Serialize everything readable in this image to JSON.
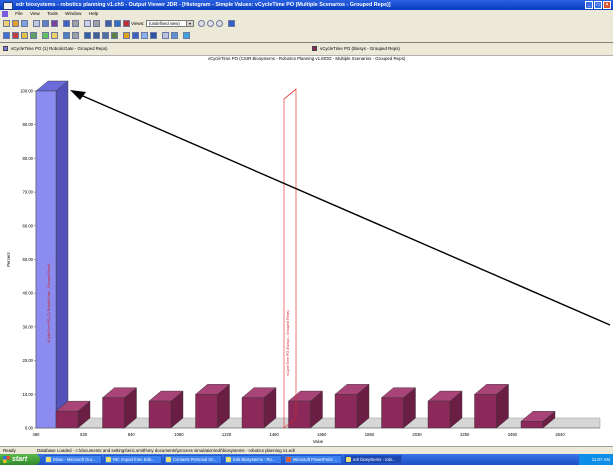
{
  "window": {
    "title": "edr biosystems - robotics planning v1.ch5 - Output Viewer JDR - [Histogram - Simple Values: vCycleTime PO (Multiple Scenarios - Grouped Reps)]"
  },
  "menu": [
    "File",
    "View",
    "Tools",
    "Window",
    "Help"
  ],
  "toolbar": {
    "views_label": "Views:",
    "views_value": "(undefined view)"
  },
  "legend": [
    {
      "label": "vCycleTime PO (1) RoboticGate - Grouped Reps)",
      "color": "#7b7be8"
    },
    {
      "label": "vCycleTime PO (Biosys - Grouped Reps)",
      "color": "#8b2a5a"
    }
  ],
  "chart_data": {
    "type": "bar",
    "title": "vCycleTime PO (CSIR Biosystems - Robotics Planning v1.MOD - Multiple Scenarios - Grouped Reps)",
    "xlabel": "Value",
    "ylabel": "Percent",
    "xlim": [
      480,
      2640
    ],
    "ylim": [
      0,
      100
    ],
    "x_ticks": [
      "480",
      "620",
      "840",
      "1060",
      "1220",
      "1460",
      "1650",
      "1860",
      "2030",
      "2250",
      "2460",
      "2640"
    ],
    "y_ticks": [
      "0.00",
      "10.00",
      "20.00",
      "30.00",
      "40.00",
      "50.00",
      "60.00",
      "70.00",
      "80.00",
      "90.00",
      "100.00"
    ],
    "series": [
      {
        "name": "vCycleTime PO (1) RoboticGate - Grouped Reps)",
        "color": "#8c8cf0",
        "bars": [
          {
            "x": 480,
            "value": 100
          }
        ]
      },
      {
        "name": "vCycleTime PO (Biosys - Grouped Reps)",
        "color": "#8b2a5a",
        "bars": [
          {
            "x": 620,
            "value": 5
          },
          {
            "x": 1000,
            "value": 9
          },
          {
            "x": 1100,
            "value": 8
          },
          {
            "x": 1220,
            "value": 10
          },
          {
            "x": 1380,
            "value": 9
          },
          {
            "x": 1580,
            "value": 8
          },
          {
            "x": 1760,
            "value": 10
          },
          {
            "x": 1940,
            "value": 9
          },
          {
            "x": 2120,
            "value": 8
          },
          {
            "x": 2320,
            "value": 10
          },
          {
            "x": 2500,
            "value": 2
          }
        ]
      }
    ],
    "annotations": [
      "vCycleTime PO (1) RoboticGate - Grouped Reps)",
      "vCycleTime PO (Biosys - Grouped Reps)"
    ],
    "grid": false
  },
  "status": {
    "ready": "Ready",
    "message": "Database Loaded - c:\\documents and settings\\eric.smith\\my documents\\process simulation\\edr\\biosystems - robotics planning v1.edr"
  },
  "taskbar": {
    "start": "start",
    "items": [
      "Inbox - Microsoft Out...",
      "RE: Import from Edit...",
      "Contacts Personal Gr...",
      "Edit Biosystems - Ro...",
      "Microsoft PowerPoint ...",
      "edr biosystems - robi..."
    ],
    "clock": "11:07 AM"
  }
}
